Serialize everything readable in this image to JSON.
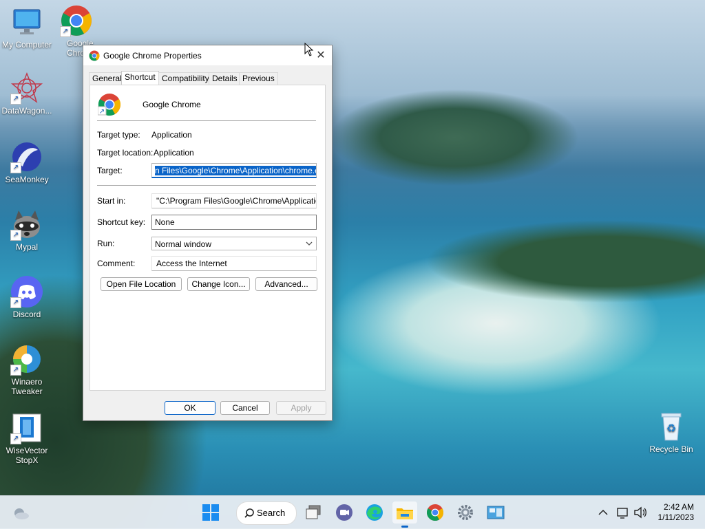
{
  "desktop": {
    "icons": [
      {
        "label": "My Computer"
      },
      {
        "label": "Google Chro"
      },
      {
        "label": "DataWagon..."
      },
      {
        "label": "SeaMonkey"
      },
      {
        "label": "Mypal"
      },
      {
        "label": "Discord"
      },
      {
        "label": "Winaero Tweaker"
      },
      {
        "label": "WiseVector StopX"
      },
      {
        "label": "Recycle Bin"
      }
    ]
  },
  "dialog": {
    "title": "Google Chrome Properties",
    "tabs": [
      "General",
      "Shortcut",
      "Compatibility",
      "Details",
      "Previous Versions"
    ],
    "active_tab": "Shortcut",
    "app_name": "Google Chrome",
    "target_type_label": "Target type:",
    "target_type_value": "Application",
    "target_location_label": "Target location:",
    "target_location_value": "Application",
    "target_label": "Target:",
    "target_value": "n Files\\Google\\Chrome\\Application\\chrome.exe\"",
    "start_in_label": "Start in:",
    "start_in_value": "\"C:\\Program Files\\Google\\Chrome\\Application\"",
    "shortcut_key_label": "Shortcut key:",
    "shortcut_key_value": "None",
    "run_label": "Run:",
    "run_value": "Normal window",
    "comment_label": "Comment:",
    "comment_value": "Access the Internet",
    "buttons": {
      "open_file_location": "Open File Location",
      "change_icon": "Change Icon...",
      "advanced": "Advanced...",
      "ok": "OK",
      "cancel": "Cancel",
      "apply": "Apply"
    }
  },
  "taskbar": {
    "search_label": "Search",
    "time": "2:42 AM",
    "date": "1/11/2023"
  },
  "colors": {
    "accent": "#0a64c8",
    "dialog_bg": "#f0f0f0"
  }
}
